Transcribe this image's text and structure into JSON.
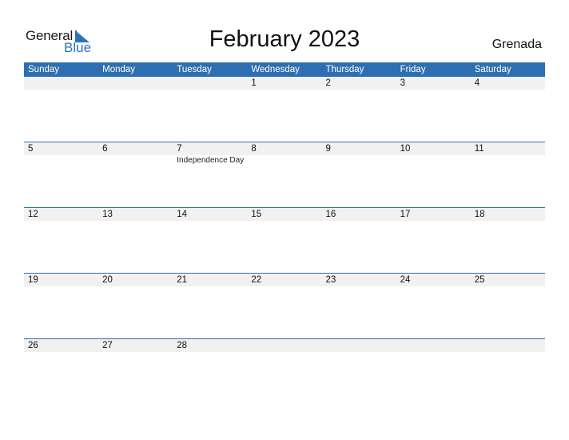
{
  "logo": {
    "word1": "General",
    "word2": "Blue",
    "icon": "triangle-flag-icon",
    "brand_color": "#2a74b8"
  },
  "title": "February 2023",
  "country": "Grenada",
  "colors": {
    "header_bg": "#2d6fb0",
    "row_bg": "#f1f1f1"
  },
  "weekdays": [
    "Sunday",
    "Monday",
    "Tuesday",
    "Wednesday",
    "Thursday",
    "Friday",
    "Saturday"
  ],
  "weeks": [
    {
      "days": [
        "",
        "",
        "",
        "1",
        "2",
        "3",
        "4"
      ],
      "events": [
        "",
        "",
        "",
        "",
        "",
        "",
        ""
      ]
    },
    {
      "days": [
        "5",
        "6",
        "7",
        "8",
        "9",
        "10",
        "11"
      ],
      "events": [
        "",
        "",
        "Independence Day",
        "",
        "",
        "",
        ""
      ]
    },
    {
      "days": [
        "12",
        "13",
        "14",
        "15",
        "16",
        "17",
        "18"
      ],
      "events": [
        "",
        "",
        "",
        "",
        "",
        "",
        ""
      ]
    },
    {
      "days": [
        "19",
        "20",
        "21",
        "22",
        "23",
        "24",
        "25"
      ],
      "events": [
        "",
        "",
        "",
        "",
        "",
        "",
        ""
      ]
    },
    {
      "days": [
        "26",
        "27",
        "28",
        "",
        "",
        "",
        ""
      ],
      "events": [
        "",
        "",
        "",
        "",
        "",
        "",
        ""
      ]
    }
  ]
}
